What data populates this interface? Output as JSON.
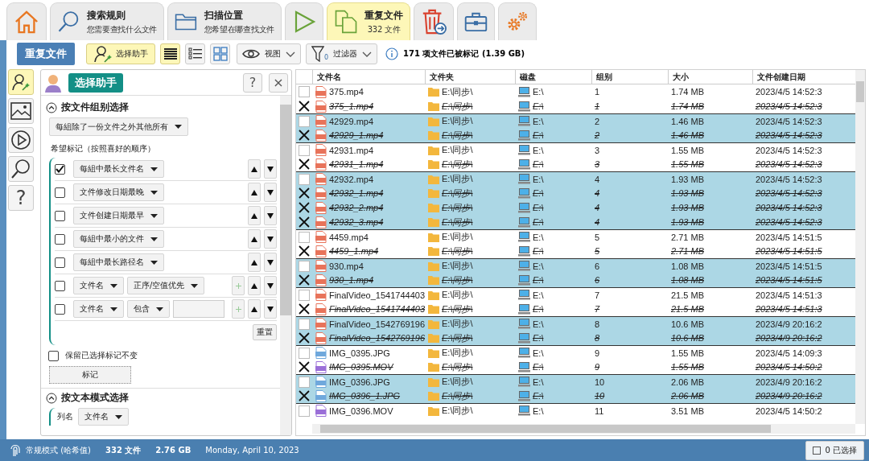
{
  "tabs": [
    {
      "kind": "home",
      "selected": false
    },
    {
      "kind": "search",
      "title": "搜索规则",
      "subtitle": "您需要查找什么文件",
      "selected": false
    },
    {
      "kind": "folder",
      "title": "扫描位置",
      "subtitle": "您希望在哪查找文件",
      "selected": false
    },
    {
      "kind": "play",
      "selected": false
    },
    {
      "kind": "duplicates",
      "title": "重复文件",
      "subtitle": "332 文件",
      "selected": true
    },
    {
      "kind": "trash",
      "selected": false
    },
    {
      "kind": "toolbox",
      "selected": false
    },
    {
      "kind": "settings",
      "selected": false
    }
  ],
  "toolbar": {
    "title_button": "重复文件",
    "assistant_button": {
      "label": "选择助手",
      "selected": true
    },
    "view_buttons": [
      {
        "kind": "details",
        "selected": true
      },
      {
        "kind": "list",
        "selected": false
      },
      {
        "kind": "grid",
        "selected": false
      }
    ],
    "view_menu": "视图",
    "filter_menu": {
      "label": "过滤器",
      "count": "0"
    },
    "info": "171 项文件已被标记 (1.39 GB)"
  },
  "side_icons": [
    {
      "kind": "assistant",
      "selected": true
    },
    {
      "kind": "image",
      "selected": false
    },
    {
      "kind": "video",
      "selected": false
    },
    {
      "kind": "search",
      "selected": false
    },
    {
      "kind": "help",
      "selected": false,
      "label": "?"
    }
  ],
  "assistant": {
    "title": "选择助手",
    "help_button": "?",
    "close_button": "×",
    "group_section": {
      "title": "按文件组别选择",
      "expanded": true,
      "mode": "每組除了一份文件之外其他所有",
      "hint": "希望标记（按照喜好的顺序）",
      "criteria": [
        {
          "kind": "simple",
          "checked": true,
          "field": "每組中最长文件名"
        },
        {
          "kind": "simple",
          "checked": false,
          "field": "文件修改日期最晚"
        },
        {
          "kind": "simple",
          "checked": false,
          "field": "文件创建日期最早"
        },
        {
          "kind": "simple",
          "checked": false,
          "field": "每組中最小的文件"
        },
        {
          "kind": "simple",
          "checked": false,
          "field": "每組中最长路径名"
        },
        {
          "kind": "sort",
          "checked": false,
          "field": "文件名",
          "order": "正序/空值优先"
        },
        {
          "kind": "match",
          "checked": false,
          "field": "文件名",
          "operator": "包含"
        }
      ],
      "reset_button": "重置",
      "keep_checkbox": {
        "label": "保留已选择标记不变",
        "checked": false
      },
      "mark_button": "标记"
    },
    "text_section": {
      "title": "按文本模式选择",
      "expanded": true,
      "column_label": "列名",
      "column_dropdown": "文件名"
    }
  },
  "table": {
    "columns": [
      "文件名",
      "文件夹",
      "磁盘",
      "组别",
      "大小",
      "文件创建日期"
    ],
    "rows": [
      {
        "name": "375.mp4",
        "folder": "E:\\同步\\",
        "drive": "E:\\",
        "group": "1",
        "size": "1.74 MB",
        "created": "2023/4/5 14:52:3",
        "kind": "mp4",
        "marked": false,
        "highlighted": false
      },
      {
        "name": "375_1.mp4",
        "folder": "E:\\同步\\",
        "drive": "E:\\",
        "group": "1",
        "size": "1.74 MB",
        "created": "2023/4/5 14:52:3",
        "kind": "mp4",
        "marked": true,
        "highlighted": false
      },
      {
        "name": "42929.mp4",
        "folder": "E:\\同步\\",
        "drive": "E:\\",
        "group": "2",
        "size": "1.46 MB",
        "created": "2023/4/5 14:52:3",
        "kind": "mp4",
        "marked": false,
        "highlighted": true
      },
      {
        "name": "42929_1.mp4",
        "folder": "E:\\同步\\",
        "drive": "E:\\",
        "group": "2",
        "size": "1.46 MB",
        "created": "2023/4/5 14:52:3",
        "kind": "mp4",
        "marked": true,
        "highlighted": true
      },
      {
        "name": "42931.mp4",
        "folder": "E:\\同步\\",
        "drive": "E:\\",
        "group": "3",
        "size": "1.55 MB",
        "created": "2023/4/5 14:52:3",
        "kind": "mp4",
        "marked": false,
        "highlighted": false
      },
      {
        "name": "42931_1.mp4",
        "folder": "E:\\同步\\",
        "drive": "E:\\",
        "group": "3",
        "size": "1.55 MB",
        "created": "2023/4/5 14:52:3",
        "kind": "mp4",
        "marked": true,
        "highlighted": false
      },
      {
        "name": "42932.mp4",
        "folder": "E:\\同步\\",
        "drive": "E:\\",
        "group": "4",
        "size": "1.93 MB",
        "created": "2023/4/5 14:52:3",
        "kind": "mp4",
        "marked": false,
        "highlighted": true
      },
      {
        "name": "42932_1.mp4",
        "folder": "E:\\同步\\",
        "drive": "E:\\",
        "group": "4",
        "size": "1.93 MB",
        "created": "2023/4/5 14:52:3",
        "kind": "mp4",
        "marked": true,
        "highlighted": true
      },
      {
        "name": "42932_2.mp4",
        "folder": "E:\\同步\\",
        "drive": "E:\\",
        "group": "4",
        "size": "1.93 MB",
        "created": "2023/4/5 14:52:3",
        "kind": "mp4",
        "marked": true,
        "highlighted": true
      },
      {
        "name": "42932_3.mp4",
        "folder": "E:\\同步\\",
        "drive": "E:\\",
        "group": "4",
        "size": "1.93 MB",
        "created": "2023/4/5 14:52:3",
        "kind": "mp4",
        "marked": true,
        "highlighted": true
      },
      {
        "name": "4459.mp4",
        "folder": "E:\\同步\\",
        "drive": "E:\\",
        "group": "5",
        "size": "2.71 MB",
        "created": "2023/4/5 14:51:5",
        "kind": "mp4",
        "marked": false,
        "highlighted": false
      },
      {
        "name": "4459_1.mp4",
        "folder": "E:\\同步\\",
        "drive": "E:\\",
        "group": "5",
        "size": "2.71 MB",
        "created": "2023/4/5 14:51:5",
        "kind": "mp4",
        "marked": true,
        "highlighted": false
      },
      {
        "name": "930.mp4",
        "folder": "E:\\同步\\",
        "drive": "E:\\",
        "group": "6",
        "size": "1.08 MB",
        "created": "2023/4/5 14:51:5",
        "kind": "mp4",
        "marked": false,
        "highlighted": true
      },
      {
        "name": "930_1.mp4",
        "folder": "E:\\同步\\",
        "drive": "E:\\",
        "group": "6",
        "size": "1.08 MB",
        "created": "2023/4/5 14:51:5",
        "kind": "mp4",
        "marked": true,
        "highlighted": true
      },
      {
        "name": "FinalVideo_1541744403",
        "folder": "E:\\同步\\",
        "drive": "E:\\",
        "group": "7",
        "size": "21.5 MB",
        "created": "2023/4/5 14:51:3",
        "kind": "mp4",
        "marked": false,
        "highlighted": false
      },
      {
        "name": "FinalVideo_1541744403",
        "folder": "E:\\同步\\",
        "drive": "E:\\",
        "group": "7",
        "size": "21.5 MB",
        "created": "2023/4/5 14:51:3",
        "kind": "mp4",
        "marked": true,
        "highlighted": false
      },
      {
        "name": "FinalVideo_1542769196",
        "folder": "E:\\同步\\",
        "drive": "E:\\",
        "group": "8",
        "size": "10.6 MB",
        "created": "2023/4/9 20:16:2",
        "kind": "mp4",
        "marked": false,
        "highlighted": true
      },
      {
        "name": "FinalVideo_1542769196",
        "folder": "E:\\同步\\",
        "drive": "E:\\",
        "group": "8",
        "size": "10.6 MB",
        "created": "2023/4/9 20:16:2",
        "kind": "mp4",
        "marked": true,
        "highlighted": true
      },
      {
        "name": "IMG_0395.JPG",
        "folder": "E:\\同步\\",
        "drive": "E:\\",
        "group": "9",
        "size": "1.55 MB",
        "created": "2023/4/5 14:09:3",
        "kind": "jpg",
        "marked": false,
        "highlighted": false
      },
      {
        "name": "IMG_0395.MOV",
        "folder": "E:\\同步\\",
        "drive": "E:\\",
        "group": "9",
        "size": "1.55 MB",
        "created": "2023/4/5 14:50:2",
        "kind": "mov",
        "marked": true,
        "highlighted": false
      },
      {
        "name": "IMG_0396.JPG",
        "folder": "E:\\同步\\",
        "drive": "E:\\",
        "group": "10",
        "size": "2.06 MB",
        "created": "2023/4/9 20:16:2",
        "kind": "jpg",
        "marked": false,
        "highlighted": true
      },
      {
        "name": "IMG_0396_1.JPG",
        "folder": "E:\\同步\\",
        "drive": "E:\\",
        "group": "10",
        "size": "2.06 MB",
        "created": "2023/4/9 20:16:2",
        "kind": "jpg",
        "marked": true,
        "highlighted": true
      },
      {
        "name": "IMG_0396.MOV",
        "folder": "E:\\同步\\",
        "drive": "E:\\",
        "group": "11",
        "size": "3.51 MB",
        "created": "2023/4/5 14:50:2",
        "kind": "mov",
        "marked": false,
        "highlighted": false
      }
    ]
  },
  "status_bar": {
    "mode": "常规模式 (哈希值)",
    "files": "332 文件",
    "size": "2.76 GB",
    "date": "Monday, April 10, 2023",
    "selected_button": "0 已选择"
  }
}
